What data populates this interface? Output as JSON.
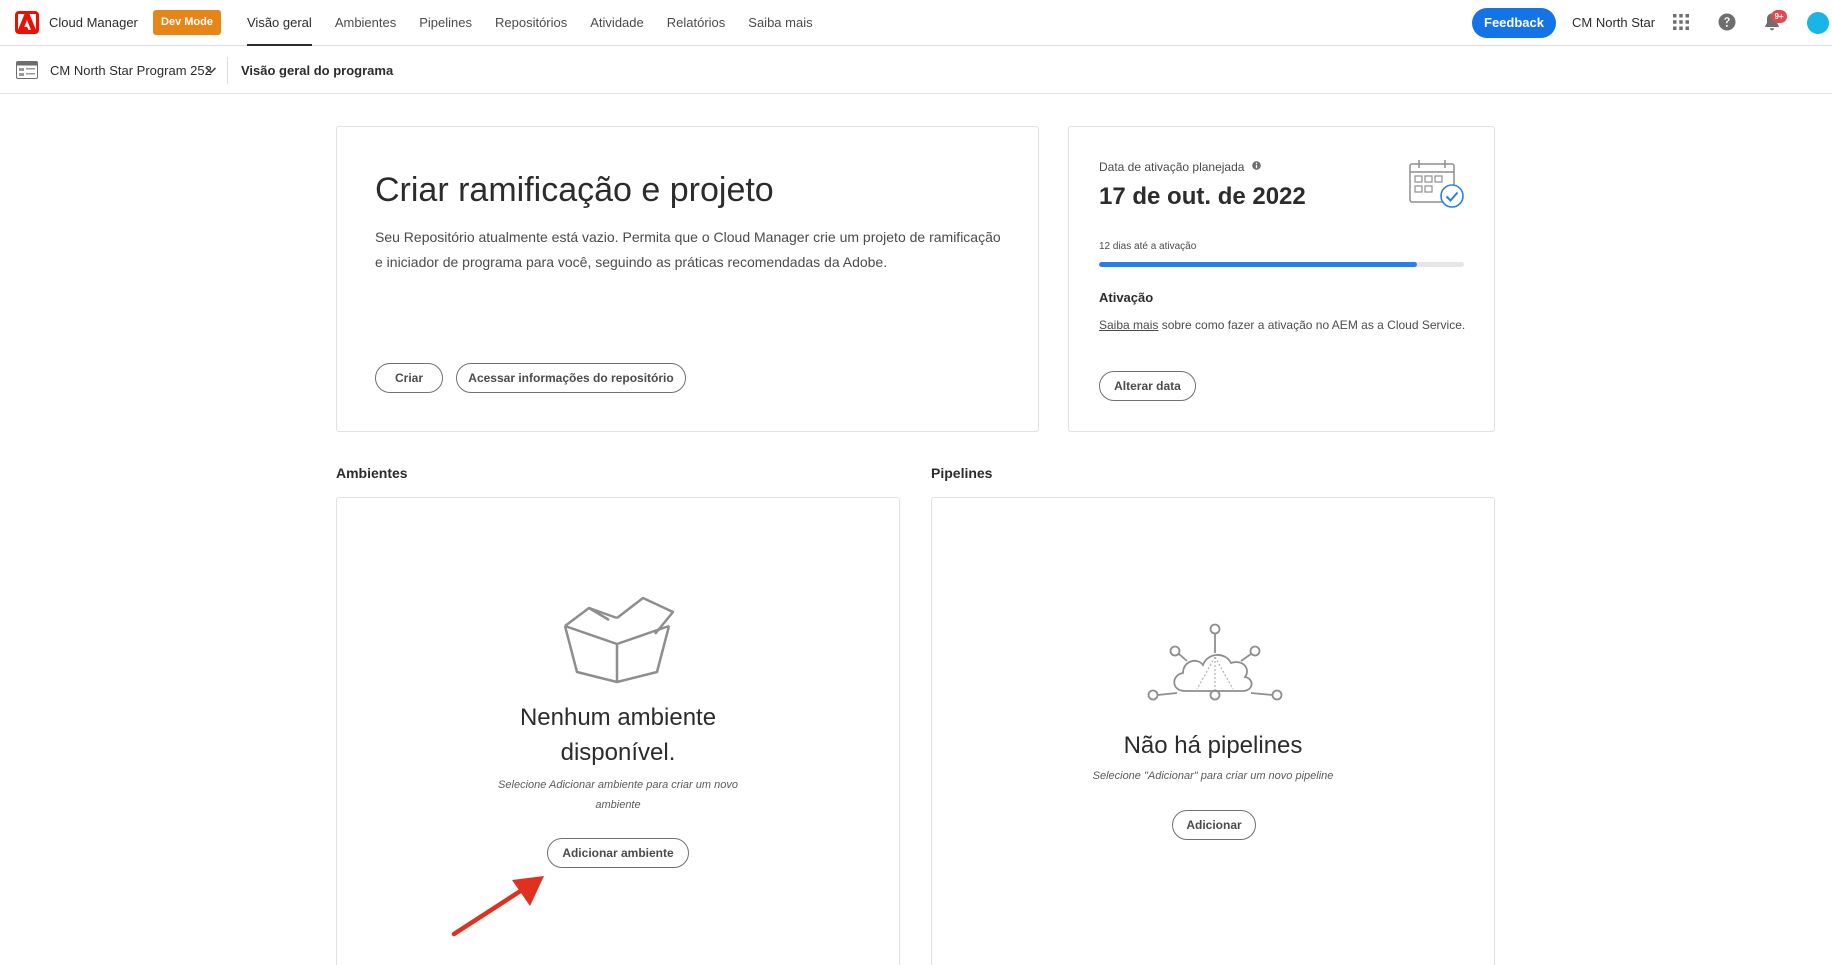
{
  "header": {
    "app_name": "Cloud Manager",
    "dev_mode_label": "Dev Mode",
    "nav": [
      {
        "label": "Visão geral",
        "active": true
      },
      {
        "label": "Ambientes"
      },
      {
        "label": "Pipelines"
      },
      {
        "label": "Repositórios"
      },
      {
        "label": "Atividade"
      },
      {
        "label": "Relatórios"
      },
      {
        "label": "Saiba mais"
      }
    ],
    "feedback_label": "Feedback",
    "org_name": "CM North Star",
    "notification_badge": "9+"
  },
  "subbar": {
    "program_name": "CM North Star Program 252",
    "page_title": "Visão geral do programa"
  },
  "create_card": {
    "title": "Criar ramificação e projeto",
    "description": "Seu Repositório atualmente está vazio. Permita que o Cloud Manager crie um projeto de ramificação e iniciador de programa para você, seguindo as práticas recomendadas da Adobe.",
    "create_button": "Criar",
    "repo_button": "Acessar informações do repositório"
  },
  "activation_card": {
    "label": "Data de ativação planejada",
    "date": "17 de out. de 2022",
    "countdown": "12 dias até a ativação",
    "progress_fraction": 0.87,
    "heading": "Ativação",
    "help_link": "Saiba mais",
    "help_text": " sobre como fazer a ativação no AEM as a Cloud Service.",
    "change_button": "Alterar data"
  },
  "environments": {
    "section_title": "Ambientes",
    "empty_title": "Nenhum ambiente disponível.",
    "empty_sub": "Selecione Adicionar ambiente para criar um novo ambiente",
    "add_button": "Adicionar ambiente"
  },
  "pipelines": {
    "section_title": "Pipelines",
    "empty_title": "Não há pipelines",
    "empty_sub": "Selecione \"Adicionar\" para criar um novo pipeline",
    "add_button": "Adicionar"
  },
  "colors": {
    "adobe_red": "#eb1000",
    "dev_mode": "#e68619",
    "accent_blue": "#1473e6",
    "progress_blue": "#2680eb",
    "annotation_arrow": "#e0301e"
  }
}
